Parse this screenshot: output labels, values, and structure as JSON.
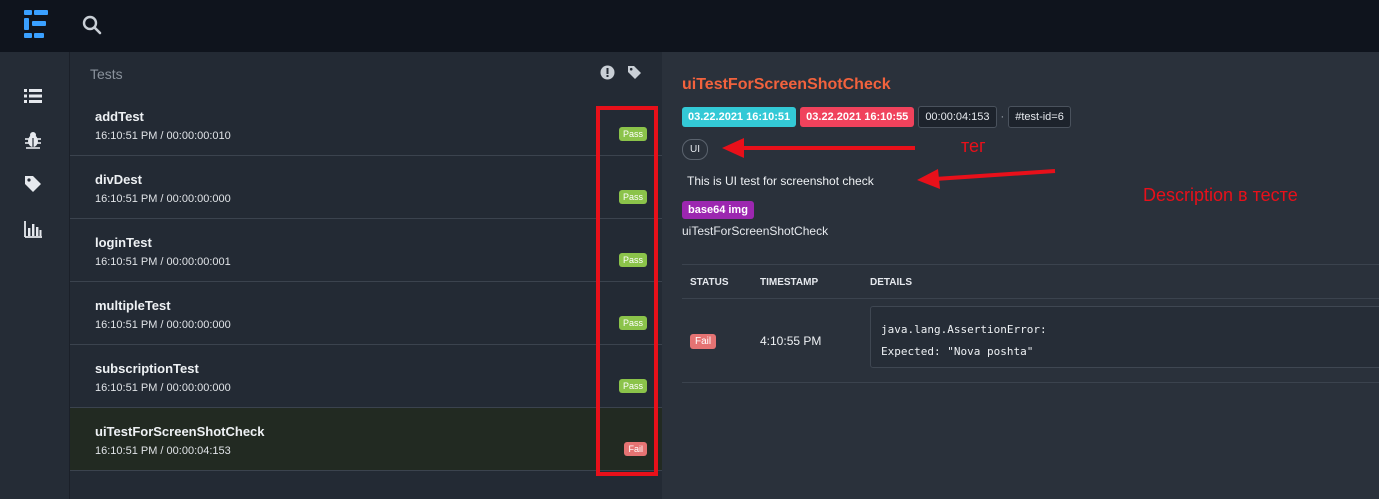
{
  "sidebar_nav": {
    "icons": [
      "list-icon",
      "bug-icon",
      "tag-icon",
      "bar-chart-icon"
    ]
  },
  "test_list": {
    "title": "Tests",
    "header_icons": [
      "exclamation-icon",
      "tag-icon"
    ],
    "items": [
      {
        "name": "addTest",
        "time": "16:10:51 PM / 00:00:00:010",
        "status": "Pass"
      },
      {
        "name": "divDest",
        "time": "16:10:51 PM / 00:00:00:000",
        "status": "Pass"
      },
      {
        "name": "loginTest",
        "time": "16:10:51 PM / 00:00:00:001",
        "status": "Pass"
      },
      {
        "name": "multipleTest",
        "time": "16:10:51 PM / 00:00:00:000",
        "status": "Pass"
      },
      {
        "name": "subscriptionTest",
        "time": "16:10:51 PM / 00:00:00:000",
        "status": "Pass"
      },
      {
        "name": "uiTestForScreenShotCheck",
        "time": "16:10:51 PM / 00:00:04:153",
        "status": "Fail"
      }
    ]
  },
  "detail": {
    "title": "uiTestForScreenShotCheck",
    "start_time": "03.22.2021 16:10:51",
    "end_time": "03.22.2021 16:10:55",
    "duration": "00:00:04:153",
    "separator": "·",
    "test_id": "#test-id=6",
    "tag": "UI",
    "description": "This is UI test for screenshot check",
    "media_badge": "base64 img",
    "media_name": "uiTestForScreenShotCheck",
    "log": {
      "headers": [
        "STATUS",
        "TIMESTAMP",
        "DETAILS"
      ],
      "rows": [
        {
          "status": "Fail",
          "timestamp": "4:10:55 PM",
          "details": "java.lang.AssertionError:\nExpected: \"Nova poshta\""
        }
      ]
    }
  },
  "annotations": {
    "teg_label": "тег",
    "description_label": "Description в тесте"
  },
  "colors": {
    "pass": "#8bc34a",
    "fail": "#e57373",
    "title_accent": "#f2623d",
    "start_pill": "#33c9d6",
    "end_pill": "#f0425c",
    "media_badge": "#9c27b0",
    "annotation_red": "#e8101a"
  }
}
